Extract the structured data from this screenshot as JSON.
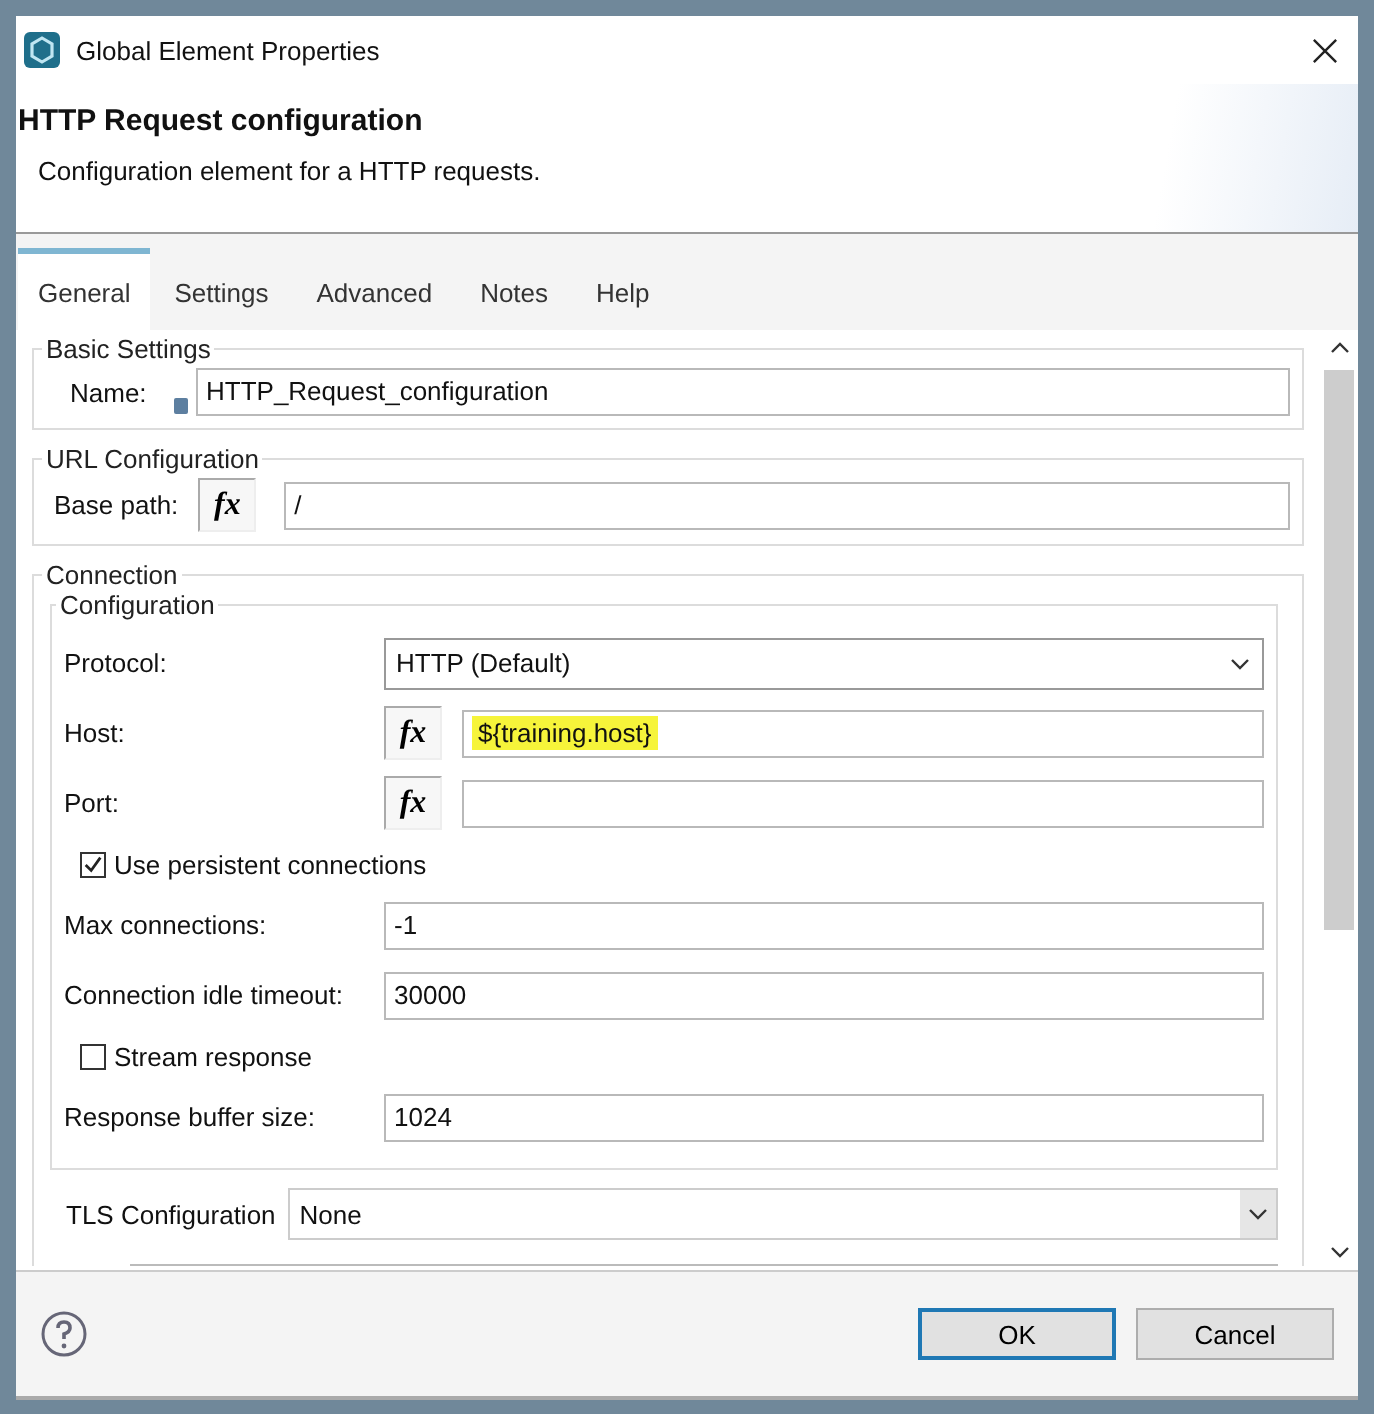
{
  "window": {
    "title": "Global Element Properties"
  },
  "header": {
    "title": "HTTP Request configuration",
    "description": "Configuration element for a HTTP requests."
  },
  "tabs": [
    {
      "label": "General",
      "selected": true
    },
    {
      "label": "Settings",
      "selected": false
    },
    {
      "label": "Advanced",
      "selected": false
    },
    {
      "label": "Notes",
      "selected": false
    },
    {
      "label": "Help",
      "selected": false
    }
  ],
  "basic_settings": {
    "legend": "Basic Settings",
    "name_label": "Name:",
    "name_value": "HTTP_Request_configuration"
  },
  "url_configuration": {
    "legend": "URL Configuration",
    "base_path_label": "Base path:",
    "expression_button": "fx",
    "base_path_value": "/"
  },
  "connection": {
    "legend": "Connection",
    "configuration": {
      "legend": "Configuration",
      "rows": [
        {
          "kind": "select",
          "label": "Protocol:",
          "value": "HTTP (Default)"
        },
        {
          "kind": "expression",
          "label": "Host:",
          "expression_button": "fx",
          "value": "${training.host}",
          "highlighted": true
        },
        {
          "kind": "expression",
          "label": "Port:",
          "expression_button": "fx"
        },
        {
          "kind": "checkbox",
          "label": "Use persistent connections",
          "checked": true
        },
        {
          "kind": "text",
          "label": "Max connections:",
          "value": "-1"
        },
        {
          "kind": "text",
          "label": "Connection idle timeout:",
          "value": "30000"
        },
        {
          "kind": "checkbox",
          "label": "Stream response",
          "checked": false
        },
        {
          "kind": "text",
          "label": "Response buffer size:",
          "value": "1024"
        }
      ]
    },
    "tls": {
      "label": "TLS Configuration",
      "value": "None"
    }
  },
  "buttons": [
    {
      "label": "OK",
      "default": true
    },
    {
      "label": "Cancel",
      "default": false
    }
  ]
}
